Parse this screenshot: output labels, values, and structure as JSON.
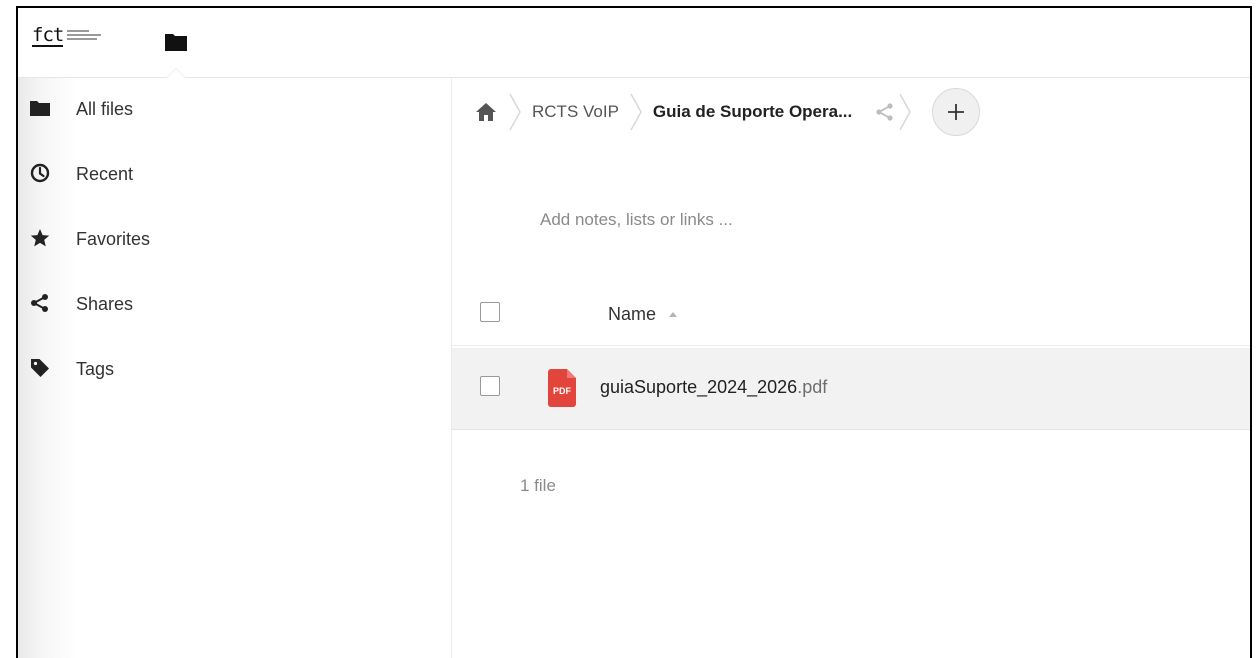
{
  "header": {
    "logo_mark": "fct",
    "logo_icon": "fct-logo",
    "app_icon": "folder-icon"
  },
  "sidebar": {
    "items": [
      {
        "label": "All files",
        "icon": "folder-icon"
      },
      {
        "label": "Recent",
        "icon": "clock-icon"
      },
      {
        "label": "Favorites",
        "icon": "star-icon"
      },
      {
        "label": "Shares",
        "icon": "share-icon"
      },
      {
        "label": "Tags",
        "icon": "tag-icon"
      }
    ]
  },
  "breadcrumb": {
    "home_icon": "home-icon",
    "items": [
      {
        "label": "RCTS VoIP"
      },
      {
        "label": "Guia de Suporte Opera..."
      }
    ],
    "share_icon": "share-icon",
    "add_icon": "plus-icon"
  },
  "notes": {
    "placeholder": "Add notes, lists or links ..."
  },
  "table": {
    "column_name": "Name",
    "sort_icon": "sort-ascending-icon",
    "rows": [
      {
        "basename": "guiaSuporte_2024_2026",
        "extension": ".pdf",
        "icon": "pdf-icon",
        "icon_label": "PDF"
      }
    ]
  },
  "summary": {
    "text": "1 file"
  },
  "colors": {
    "pdf_red": "#e2453c",
    "icon_dark": "#222222",
    "text_muted": "#8a8a8a",
    "row_hover": "#f2f2f2"
  }
}
